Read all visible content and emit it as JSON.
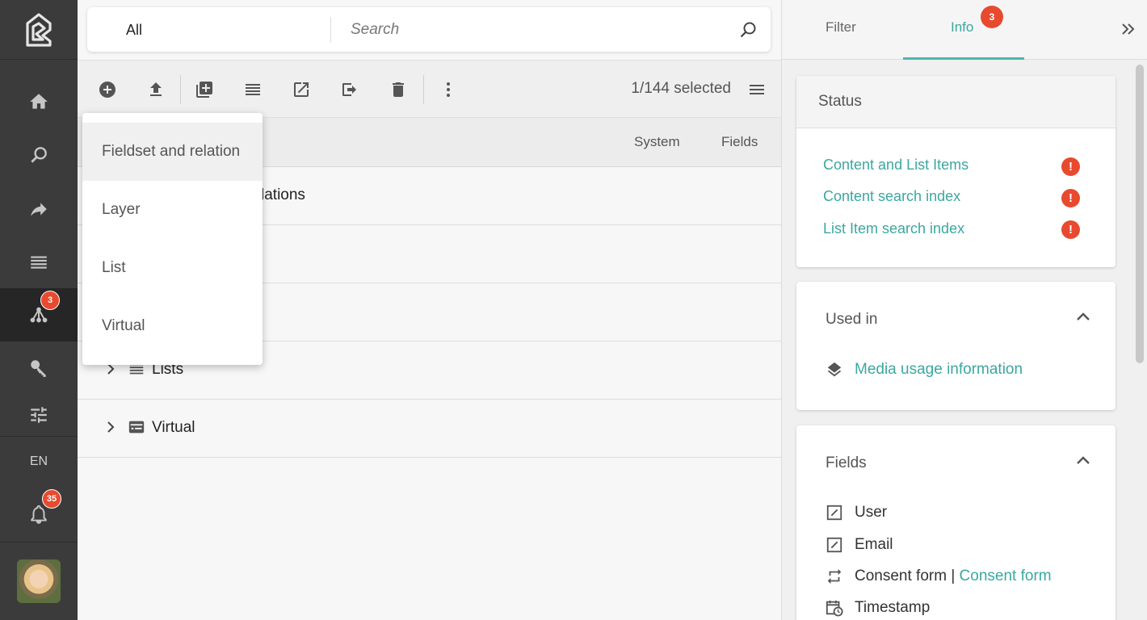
{
  "sidebar": {
    "items": [
      {
        "name": "home",
        "icon": "home-icon"
      },
      {
        "name": "search",
        "icon": "search-icon"
      },
      {
        "name": "share",
        "icon": "share-icon"
      },
      {
        "name": "lists",
        "icon": "list-icon"
      },
      {
        "name": "schemas",
        "icon": "tree-icon",
        "badge": "3"
      },
      {
        "name": "keys",
        "icon": "key-icon"
      },
      {
        "name": "settings",
        "icon": "sliders-icon"
      }
    ],
    "language": "EN",
    "notifications_badge": "35"
  },
  "search": {
    "scope": "All",
    "placeholder": "Search"
  },
  "toolbar": {
    "selected_count": "1/144 selected"
  },
  "table": {
    "columns": [
      "System",
      "Fields"
    ],
    "rows": [
      {
        "label": "lations",
        "icon": "fieldset-icon"
      },
      {
        "label": "",
        "icon": "layer-icon"
      },
      {
        "label": "",
        "icon": "list-icon"
      },
      {
        "label": "Lists",
        "icon": "list-icon"
      },
      {
        "label": "Virtual",
        "icon": "virtual-icon"
      }
    ]
  },
  "dropdown": {
    "items": [
      "Fieldset and relation",
      "Layer",
      "List",
      "Virtual"
    ]
  },
  "right_panel": {
    "tabs": {
      "filter": "Filter",
      "info": "Info",
      "info_badge": "3"
    },
    "status": {
      "title": "Status",
      "links": [
        "Content and List Items",
        "Content search index",
        "List Item search index"
      ],
      "warning_symbol": "!"
    },
    "used_in": {
      "title": "Used in",
      "link": "Media usage information"
    },
    "fields": {
      "title": "Fields",
      "items": [
        {
          "label": "User",
          "icon": "edit-box-icon"
        },
        {
          "label": "Email",
          "icon": "edit-box-icon"
        },
        {
          "label": "Consent form",
          "separator": " | ",
          "link": "Consent form",
          "icon": "relation-icon"
        },
        {
          "label": "Timestamp",
          "icon": "calendar-clock-icon"
        }
      ]
    }
  },
  "colors": {
    "sidebar": "#3b3b3b",
    "accent": "#3aa8a0",
    "badge": "#e84a2f"
  }
}
